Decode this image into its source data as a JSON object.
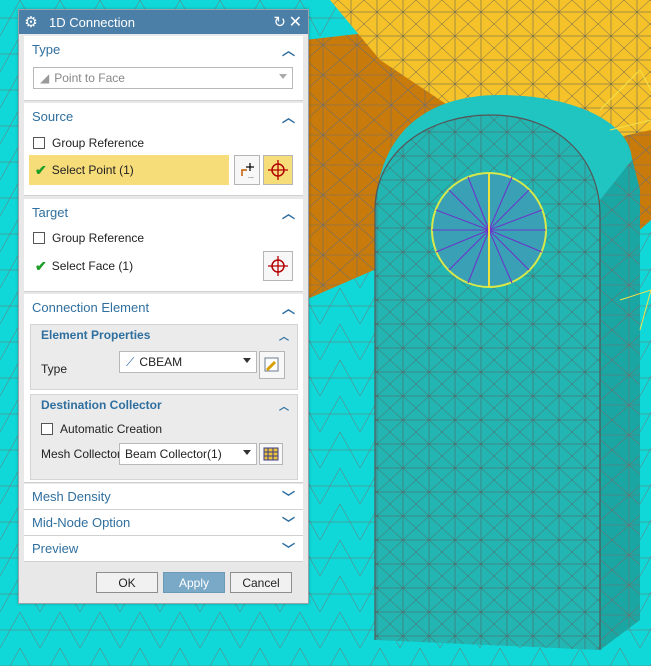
{
  "dialog": {
    "title": "1D Connection",
    "icons": {
      "settings": "gear-icon",
      "reset": "reset-icon",
      "close": "close-icon"
    }
  },
  "type_section": {
    "header": "Type",
    "dropdown_value": "Point to Face"
  },
  "source_section": {
    "header": "Source",
    "group_reference_label": "Group Reference",
    "select_label": "Select Point (1)"
  },
  "target_section": {
    "header": "Target",
    "group_reference_label": "Group Reference",
    "select_label": "Select Face (1)"
  },
  "connection_element": {
    "header": "Connection Element",
    "element_properties": {
      "header": "Element Properties",
      "type_label": "Type",
      "type_value": "CBEAM"
    },
    "destination_collector": {
      "header": "Destination Collector",
      "automatic_creation_label": "Automatic Creation",
      "mesh_collector_label": "Mesh Collector",
      "mesh_collector_value": "Beam Collector(1)"
    }
  },
  "collapsed_sections": {
    "mesh_density": "Mesh Density",
    "mid_node_option": "Mid-Node Option",
    "preview": "Preview"
  },
  "buttons": {
    "ok": "OK",
    "apply": "Apply",
    "cancel": "Cancel"
  },
  "colors": {
    "title_bar": "#4b7fa8",
    "section_header": "#2f6f9f",
    "highlight": "#f7dc7a",
    "mesh_cyan": "#10d8d8",
    "mesh_orange": "#c87a0a",
    "mesh_yellow": "#f5c22a",
    "part_teal": "#21b7b4"
  }
}
